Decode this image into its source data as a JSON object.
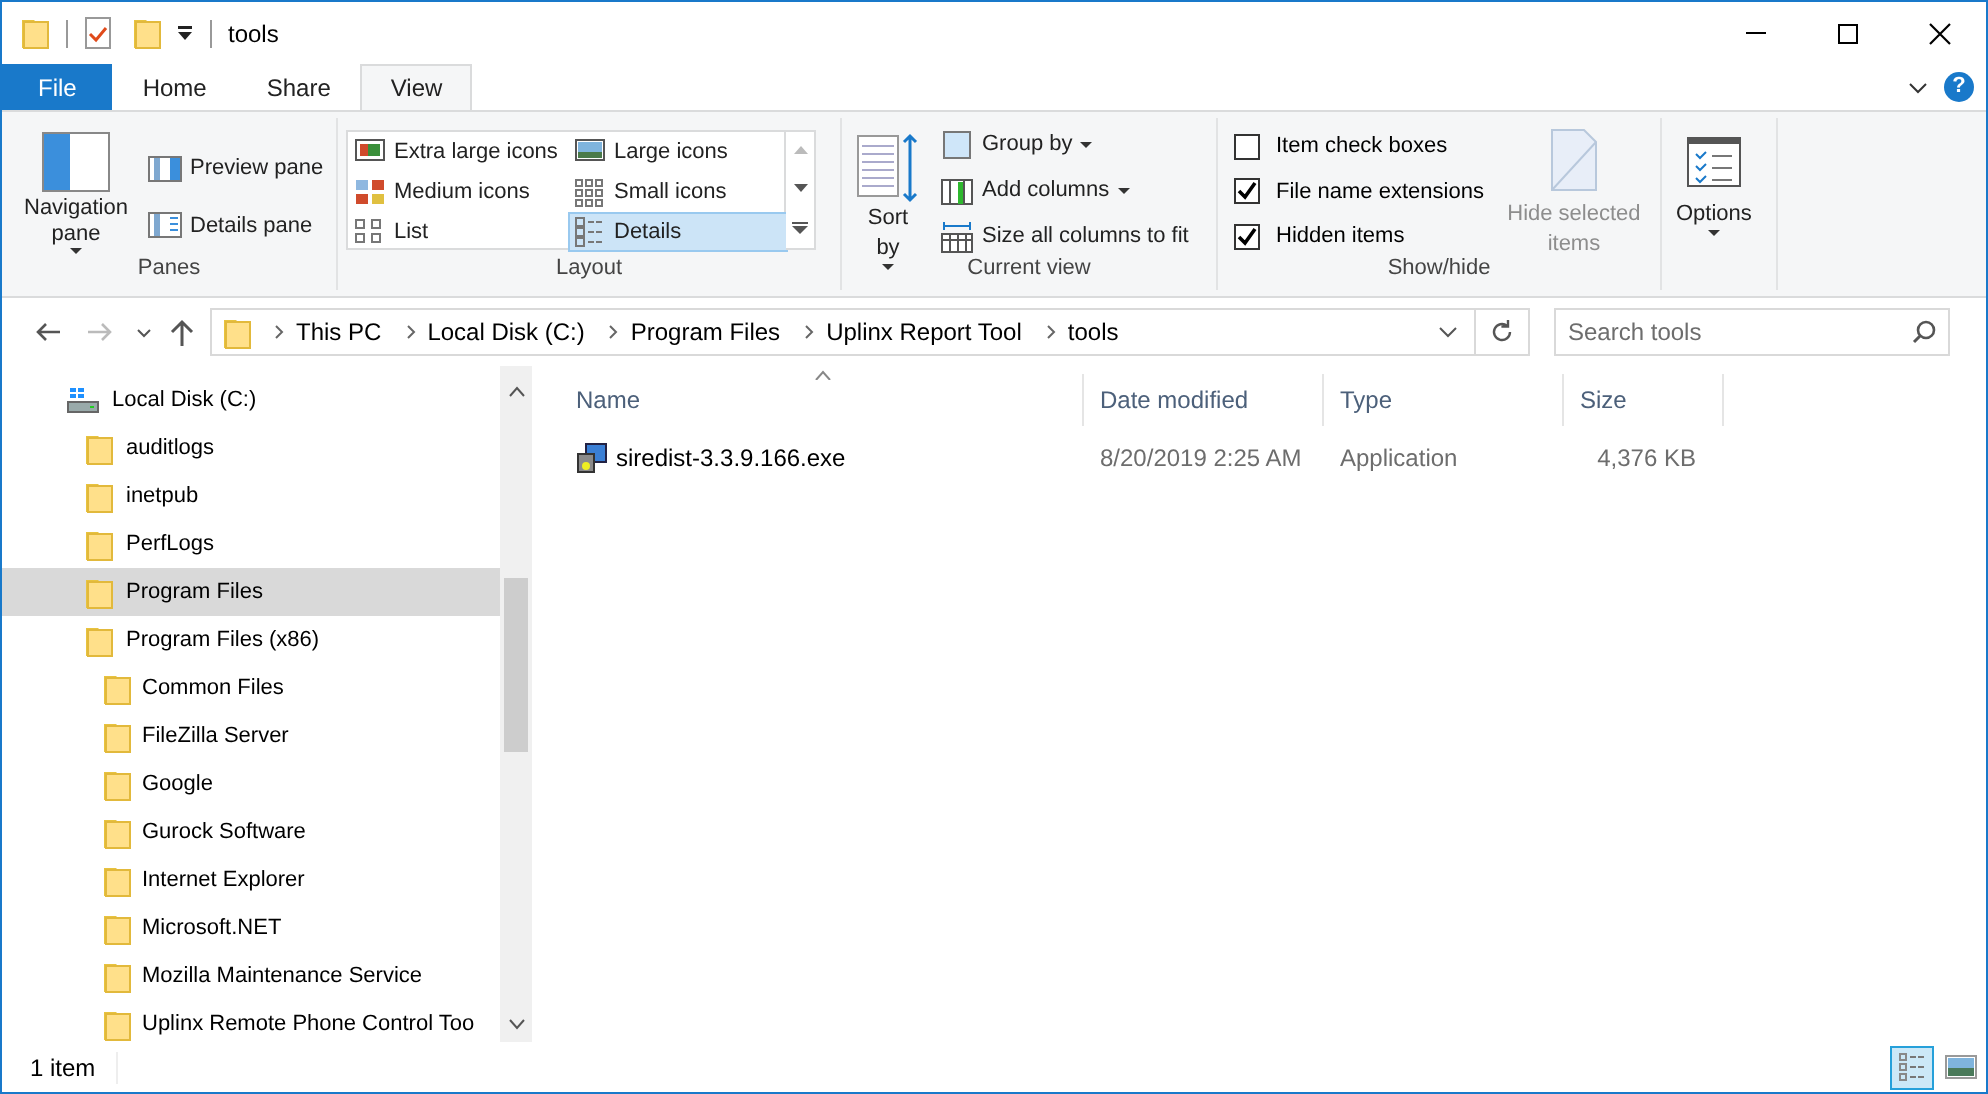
{
  "window": {
    "title": "tools"
  },
  "ribbon_tabs": [
    {
      "label": "File",
      "kind": "file",
      "selected": false
    },
    {
      "label": "Home",
      "kind": "tab",
      "selected": false
    },
    {
      "label": "Share",
      "kind": "tab",
      "selected": false
    },
    {
      "label": "View",
      "kind": "tab",
      "selected": true
    }
  ],
  "help": "?",
  "panes_group": {
    "label": "Panes",
    "navigation_pane": "Navigation pane",
    "preview_pane": "Preview pane",
    "details_pane": "Details pane"
  },
  "layout_group": {
    "label": "Layout",
    "options": [
      {
        "label": "Extra large icons",
        "selected": false
      },
      {
        "label": "Large icons",
        "selected": false
      },
      {
        "label": "Medium icons",
        "selected": false
      },
      {
        "label": "Small icons",
        "selected": false
      },
      {
        "label": "List",
        "selected": false
      },
      {
        "label": "Details",
        "selected": true
      }
    ]
  },
  "current_view_group": {
    "label": "Current view",
    "sort_by": "Sort by",
    "commands": [
      {
        "label": "Group by",
        "dropdown": true
      },
      {
        "label": "Add columns",
        "dropdown": true
      },
      {
        "label": "Size all columns to fit",
        "dropdown": false
      }
    ]
  },
  "show_hide_group": {
    "label": "Show/hide",
    "checkboxes": [
      {
        "label": "Item check boxes",
        "checked": false
      },
      {
        "label": "File name extensions",
        "checked": true
      },
      {
        "label": "Hidden items",
        "checked": true
      }
    ],
    "hide_selected": {
      "label": "Hide selected items",
      "disabled": true
    }
  },
  "options": {
    "label": "Options"
  },
  "breadcrumbs": [
    "This PC",
    "Local Disk (C:)",
    "Program Files",
    "Uplinx Report Tool",
    "tools"
  ],
  "search": {
    "placeholder": "Search tools"
  },
  "nav_tree": [
    {
      "label": "Local Disk (C:)",
      "kind": "drive",
      "selected": false,
      "children": [
        {
          "label": "auditlogs",
          "kind": "folder",
          "selected": false
        },
        {
          "label": "inetpub",
          "kind": "folder",
          "selected": false
        },
        {
          "label": "PerfLogs",
          "kind": "folder",
          "selected": false
        },
        {
          "label": "Program Files",
          "kind": "folder",
          "selected": true
        },
        {
          "label": "Program Files (x86)",
          "kind": "folder",
          "selected": false,
          "children": [
            {
              "label": "Common Files",
              "kind": "folder",
              "selected": false
            },
            {
              "label": "FileZilla Server",
              "kind": "folder",
              "selected": false
            },
            {
              "label": "Google",
              "kind": "folder",
              "selected": false
            },
            {
              "label": "Gurock Software",
              "kind": "folder",
              "selected": false
            },
            {
              "label": "Internet Explorer",
              "kind": "folder",
              "selected": false
            },
            {
              "label": "Microsoft.NET",
              "kind": "folder",
              "selected": false
            },
            {
              "label": "Mozilla Maintenance Service",
              "kind": "folder",
              "selected": false
            },
            {
              "label": "Uplinx Remote Phone Control Too",
              "kind": "folder",
              "selected": false
            }
          ]
        }
      ]
    }
  ],
  "table": {
    "columns": [
      {
        "label": "Name",
        "sorted": true
      },
      {
        "label": "Date modified",
        "sorted": false
      },
      {
        "label": "Type",
        "sorted": false
      },
      {
        "label": "Size",
        "sorted": false
      }
    ],
    "rows": [
      [
        "siredist-3.3.9.166.exe",
        "8/20/2019 2:25 AM",
        "Application",
        "4,376 KB"
      ]
    ]
  },
  "status_bar": {
    "text": "1 item",
    "view_toggles": [
      {
        "kind": "details",
        "selected": true
      },
      {
        "kind": "large",
        "selected": false
      }
    ]
  }
}
